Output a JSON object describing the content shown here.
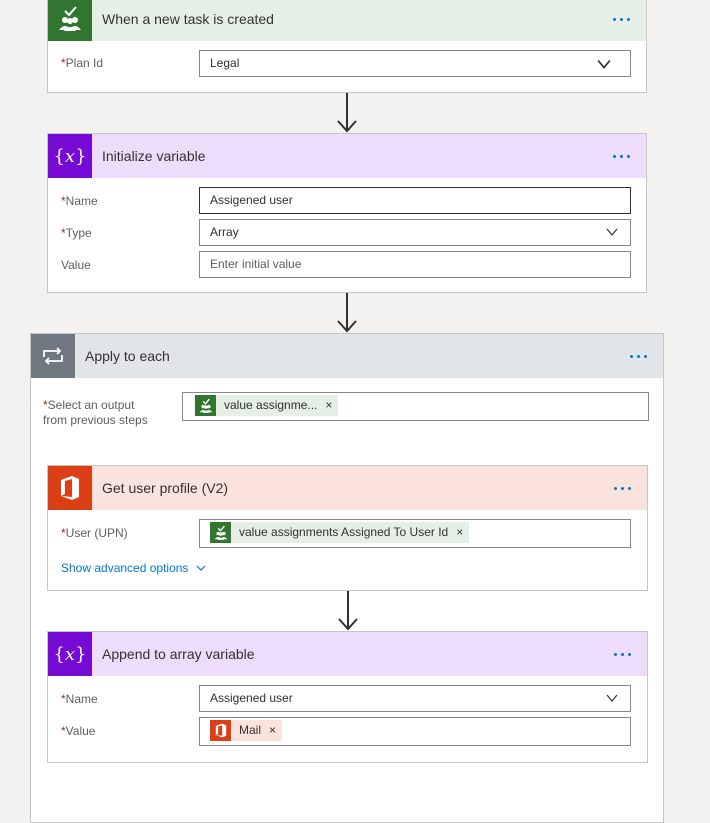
{
  "trigger": {
    "title": "When a new task is created",
    "plan_id_label": "Plan Id",
    "plan_id_value": "Legal"
  },
  "init_variable": {
    "title": "Initialize variable",
    "name_label": "Name",
    "name_value": "Assigened user",
    "type_label": "Type",
    "type_value": "Array",
    "value_label": "Value",
    "value_placeholder": "Enter initial value"
  },
  "apply_each": {
    "title": "Apply to each",
    "select_label_line1": "Select an output",
    "select_label_line2": "from previous steps",
    "token_label": "value assignme..."
  },
  "get_user": {
    "title": "Get user profile (V2)",
    "upn_label": "User (UPN)",
    "token_label": "value assignments Assigned To User Id",
    "advanced_link": "Show advanced options"
  },
  "append_var": {
    "title": "Append to array variable",
    "name_label": "Name",
    "name_value": "Assigened user",
    "value_label": "Value",
    "token_label": "Mail"
  },
  "icons": {
    "planner": "planner-icon",
    "variable": "variable-icon",
    "loop": "loop-icon",
    "office": "office-icon"
  },
  "colors": {
    "planner_green": "#31752f",
    "planner_header": "#e6efe6",
    "variable_purple": "#770bd6",
    "variable_header": "#eedcfb",
    "loop_gray": "#6f7780",
    "loop_header": "#e1e5e7",
    "office_orange": "#dc3e15",
    "office_header": "#fbe3dd",
    "accent": "#0078d4",
    "required": "#a4262c"
  }
}
